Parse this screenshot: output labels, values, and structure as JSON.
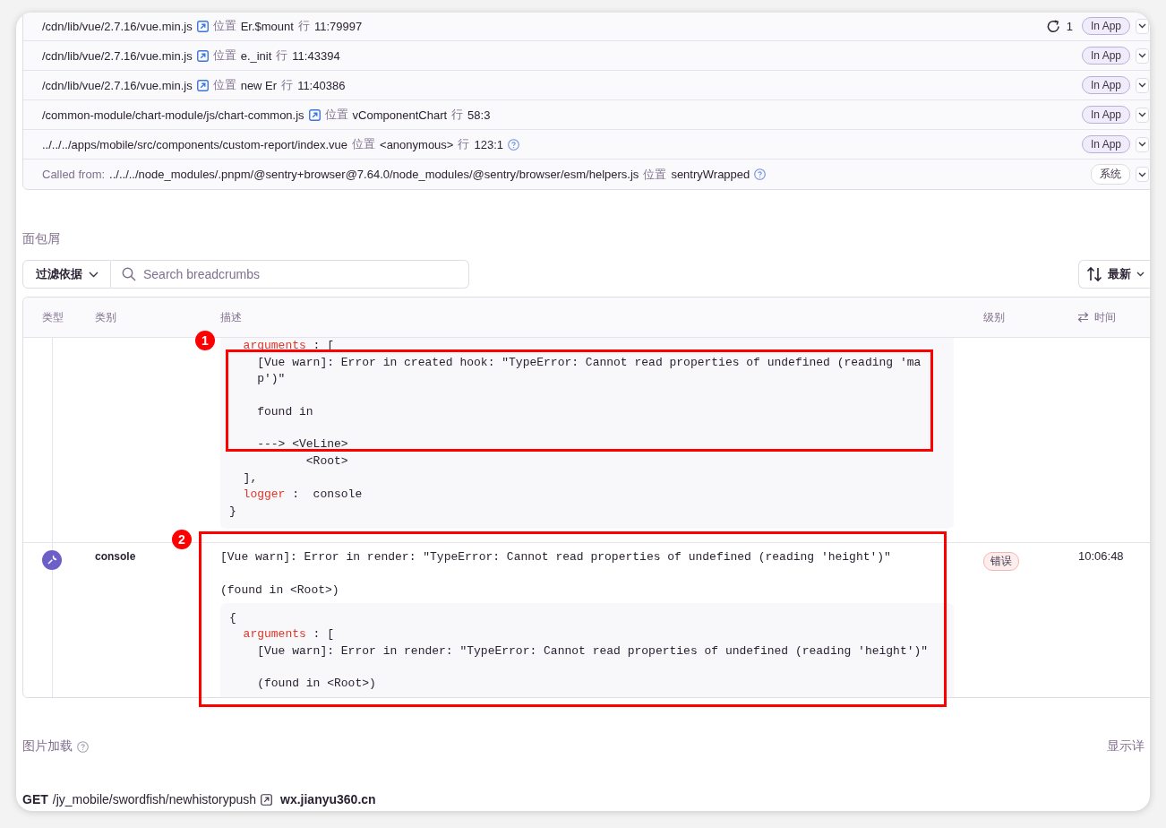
{
  "frames": [
    {
      "file": "/cdn/lib/vue/2.7.16/vue.min.js",
      "link_icon": true,
      "at_label": "位置",
      "function": "Er.$mount",
      "line_label": "行",
      "line": "11:79997",
      "help_icon": false,
      "repeat": "1",
      "badge": {
        "label": "In App",
        "kind": "in_app"
      }
    },
    {
      "file": "/cdn/lib/vue/2.7.16/vue.min.js",
      "link_icon": true,
      "at_label": "位置",
      "function": "e._init",
      "line_label": "行",
      "line": "11:43394",
      "help_icon": false,
      "badge": {
        "label": "In App",
        "kind": "in_app"
      }
    },
    {
      "file": "/cdn/lib/vue/2.7.16/vue.min.js",
      "link_icon": true,
      "at_label": "位置",
      "function": "new Er",
      "line_label": "行",
      "line": "11:40386",
      "help_icon": false,
      "badge": {
        "label": "In App",
        "kind": "in_app"
      }
    },
    {
      "file": "/common-module/chart-module/js/chart-common.js",
      "link_icon": true,
      "at_label": "位置",
      "function": "vComponentChart",
      "line_label": "行",
      "line": "58:3",
      "help_icon": false,
      "badge": {
        "label": "In App",
        "kind": "in_app"
      }
    },
    {
      "file": "../../../apps/mobile/src/components/custom-report/index.vue",
      "link_icon": false,
      "at_label": "位置",
      "function": "<anonymous>",
      "line_label": "行",
      "line": "123:1",
      "help_icon": true,
      "badge": {
        "label": "In App",
        "kind": "in_app"
      }
    },
    {
      "prefix": "Called from:",
      "file": "../../../node_modules/.pnpm/@sentry+browser@7.64.0/node_modules/@sentry/browser/esm/helpers.js",
      "link_icon": false,
      "at_label": "位置",
      "function": "sentryWrapped",
      "help_icon": true,
      "badge": {
        "label": "系统",
        "kind": "system"
      }
    }
  ],
  "breadcrumbs": {
    "title": "面包屑",
    "filter": {
      "label": "过滤依据"
    },
    "search": {
      "placeholder": "Search breadcrumbs"
    },
    "sort": {
      "label": "最新"
    },
    "columns": [
      {
        "label": "类型",
        "sortable": false
      },
      {
        "label": "类别",
        "sortable": false
      },
      {
        "label": "描述",
        "sortable": false
      },
      {
        "label": "级别",
        "sortable": false
      },
      {
        "label": "时间",
        "sortable": true
      }
    ],
    "rows": [
      {
        "code": [
          {
            "kind": "key",
            "key": "arguments",
            "rest": " : ["
          },
          {
            "kind": "text",
            "text": "    [Vue warn]: Error in created hook: \"TypeError: Cannot read properties of undefined (reading 'ma"
          },
          {
            "kind": "text",
            "text": "    p')\""
          },
          {
            "kind": "blank"
          },
          {
            "kind": "text",
            "text": "    found in"
          },
          {
            "kind": "blank"
          },
          {
            "kind": "text",
            "text": "    ---> <VeLine>"
          },
          {
            "kind": "text",
            "text": "           <Root>"
          },
          {
            "kind": "text",
            "text": "  ],"
          },
          {
            "kind": "key",
            "key": "logger",
            "rest": " :  console"
          },
          {
            "kind": "text",
            "text": "}"
          }
        ]
      },
      {
        "kind": "console",
        "category": "console",
        "message": [
          {
            "kind": "text",
            "text": "[Vue warn]: Error in render: \"TypeError: Cannot read properties of undefined (reading 'height')\""
          },
          {
            "kind": "blank"
          },
          {
            "kind": "text",
            "text": "(found in <Root>)"
          }
        ],
        "code": [
          {
            "kind": "text",
            "text": "{"
          },
          {
            "kind": "key",
            "key": "arguments",
            "rest": " : ["
          },
          {
            "kind": "text",
            "text": "    [Vue warn]: Error in render: \"TypeError: Cannot read properties of undefined (reading 'height')\""
          },
          {
            "kind": "blank"
          },
          {
            "kind": "text",
            "text": "    (found in <Root>)"
          }
        ],
        "level": {
          "label": "错误",
          "kind": "error"
        },
        "time": "10:06:48"
      }
    ]
  },
  "section": {
    "title": "图片加载",
    "help_icon": true,
    "action": "显示详"
  },
  "request": {
    "method": "GET",
    "path": "/jy_mobile/swordfish/newhistorypush",
    "link_icon": true,
    "host": "wx.jianyu360.cn"
  },
  "annotations": [
    {
      "number": "1"
    },
    {
      "number": "2"
    }
  ]
}
